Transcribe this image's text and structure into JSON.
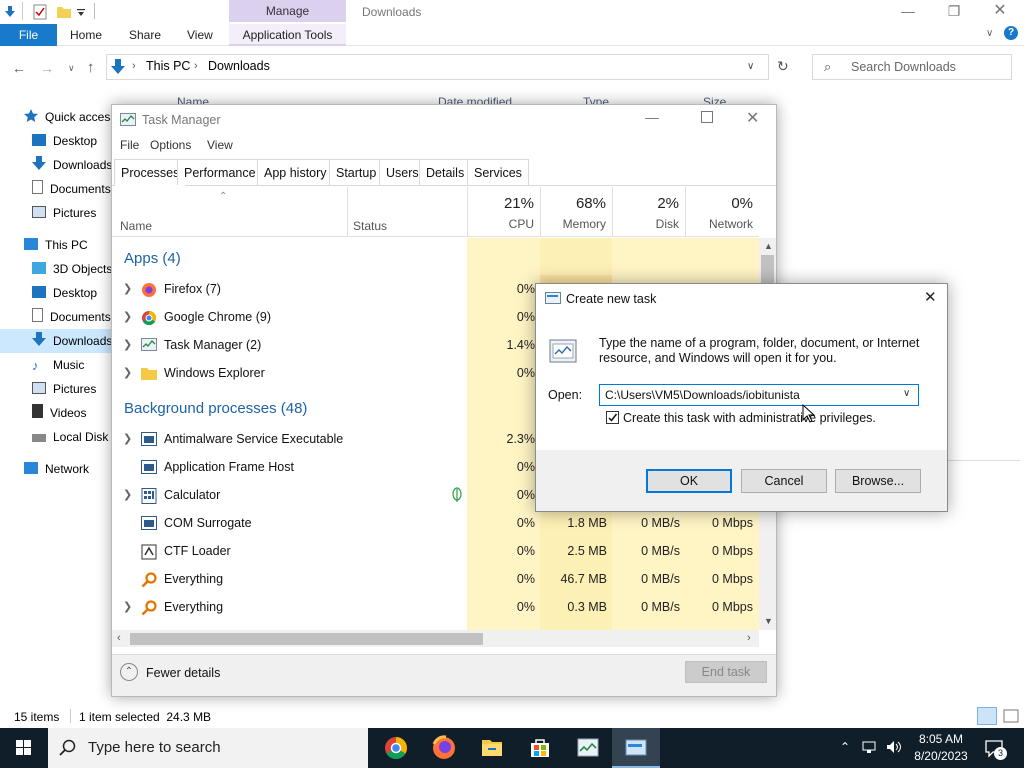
{
  "explorer": {
    "manage_tab": "Manage",
    "window_title": "Downloads",
    "ribbon_tabs": {
      "file": "File",
      "home": "Home",
      "share": "Share",
      "view": "View",
      "app_tools": "Application Tools"
    },
    "breadcrumb": {
      "this_pc": "This PC",
      "downloads": "Downloads"
    },
    "search_placeholder": "Search Downloads",
    "columns": {
      "name": "Name",
      "date_modified": "Date modified",
      "type": "Type",
      "size": "Size"
    },
    "nav": [
      "Quick access",
      "Desktop",
      "Downloads",
      "Documents",
      "Pictures",
      "This PC",
      "3D Objects",
      "Desktop",
      "Documents",
      "Downloads",
      "Music",
      "Pictures",
      "Videos",
      "Local Disk (C:)",
      "Network"
    ],
    "status": {
      "items": "15 items",
      "selected": "1 item selected  24.3 MB"
    }
  },
  "taskmgr": {
    "title": "Task Manager",
    "menu": {
      "file": "File",
      "options": "Options",
      "view": "View"
    },
    "tabs": [
      "Processes",
      "Performance",
      "App history",
      "Startup",
      "Users",
      "Details",
      "Services"
    ],
    "headers": {
      "name": "Name",
      "status": "Status",
      "cpu_pct": "21%",
      "cpu": "CPU",
      "mem_pct": "68%",
      "mem": "Memory",
      "disk_pct": "2%",
      "disk": "Disk",
      "net_pct": "0%",
      "net": "Network"
    },
    "apps_group": "Apps (4)",
    "apps": [
      {
        "name": "Firefox (7)",
        "cpu": "0%"
      },
      {
        "name": "Google Chrome (9)",
        "cpu": "0%"
      },
      {
        "name": "Task Manager (2)",
        "cpu": "1.4%"
      },
      {
        "name": "Windows Explorer",
        "cpu": "0%"
      }
    ],
    "bg_group": "Background processes (48)",
    "bg": [
      {
        "name": "Antimalware Service Executable",
        "cpu": "2.3%"
      },
      {
        "name": "Application Frame Host",
        "cpu": "0%"
      },
      {
        "name": "Calculator",
        "cpu": "0%"
      },
      {
        "name": "COM Surrogate",
        "cpu": "0%",
        "mem": "1.8 MB",
        "disk": "0 MB/s",
        "net": "0 Mbps"
      },
      {
        "name": "CTF Loader",
        "cpu": "0%",
        "mem": "2.5 MB",
        "disk": "0 MB/s",
        "net": "0 Mbps"
      },
      {
        "name": "Everything",
        "cpu": "0%",
        "mem": "46.7 MB",
        "disk": "0 MB/s",
        "net": "0 Mbps"
      },
      {
        "name": "Everything",
        "cpu": "0%",
        "mem": "0.3 MB",
        "disk": "0 MB/s",
        "net": "0 Mbps"
      }
    ],
    "fewer_details": "Fewer details",
    "end_task": "End task"
  },
  "run_dialog": {
    "title": "Create new task",
    "description": "Type the name of a program, folder, document, or Internet resource, and Windows will open it for you.",
    "open_label": "Open:",
    "open_value": "C:\\Users\\VM5\\Downloads/iobitunista",
    "admin_checkbox_label": "Create this task with administrative privileges.",
    "admin_checked": true,
    "ok": "OK",
    "cancel": "Cancel",
    "browse": "Browse..."
  },
  "taskbar": {
    "search_placeholder": "Type here to search",
    "time": "8:05 AM",
    "date": "8/20/2023",
    "notifications_count": "3"
  },
  "colors": {
    "accent": "#0078d7",
    "file_tab": "#1979ca",
    "manage_tab": "#dcd0ef",
    "cpu_heat": "#fff4c4",
    "group_text": "#1e63a8",
    "taskbar": "#101e2a"
  }
}
